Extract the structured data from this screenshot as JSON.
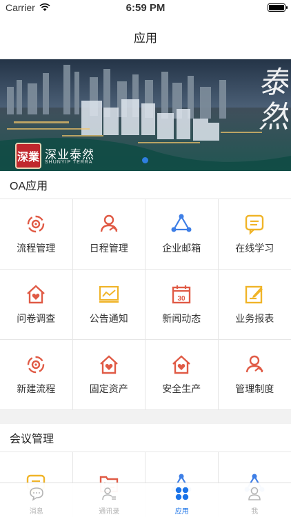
{
  "status_bar": {
    "carrier": "Carrier",
    "time": "6:59 PM",
    "battery_level": 1.0
  },
  "navbar": {
    "title": "应用"
  },
  "banner": {
    "brand_mark": "深業",
    "brand_name": "深业泰然",
    "brand_sub": "SHUNYIP TERRA",
    "calligraphy": "泰然",
    "current_page": 1
  },
  "colors": {
    "accent": "#1a73e8",
    "red": "#e05a45",
    "blue": "#3d7ee6",
    "yellow": "#f0b428"
  },
  "oa_section": {
    "title": "OA应用",
    "items": [
      {
        "label": "流程管理",
        "icon": "process-icon"
      },
      {
        "label": "日程管理",
        "icon": "schedule-user-icon"
      },
      {
        "label": "企业邮箱",
        "icon": "mail-network-icon"
      },
      {
        "label": "在线学习",
        "icon": "chat-learn-icon"
      },
      {
        "label": "问卷调查",
        "icon": "house-heart-icon"
      },
      {
        "label": "公告通知",
        "icon": "chart-board-icon"
      },
      {
        "label": "新闻动态",
        "icon": "calendar-30-icon"
      },
      {
        "label": "业务报表",
        "icon": "report-edit-icon"
      },
      {
        "label": "新建流程",
        "icon": "process-icon"
      },
      {
        "label": "固定资产",
        "icon": "house-heart-icon"
      },
      {
        "label": "安全生产",
        "icon": "house-heart-icon"
      },
      {
        "label": "管理制度",
        "icon": "schedule-user-icon"
      }
    ]
  },
  "meeting_section": {
    "title": "会议管理",
    "items": [
      {
        "label": "",
        "icon": "chat-learn-icon"
      },
      {
        "label": "",
        "icon": "list-doc-icon"
      },
      {
        "label": "",
        "icon": "mail-network-icon"
      },
      {
        "label": "",
        "icon": "mail-network-icon"
      }
    ]
  },
  "tabbar": {
    "tabs": [
      {
        "label": "消息",
        "icon": "chat-bubble-icon",
        "active": false
      },
      {
        "label": "通讯录",
        "icon": "contacts-icon",
        "active": false
      },
      {
        "label": "应用",
        "icon": "apps-grid-icon",
        "active": true
      },
      {
        "label": "我",
        "icon": "profile-icon",
        "active": false
      }
    ]
  }
}
